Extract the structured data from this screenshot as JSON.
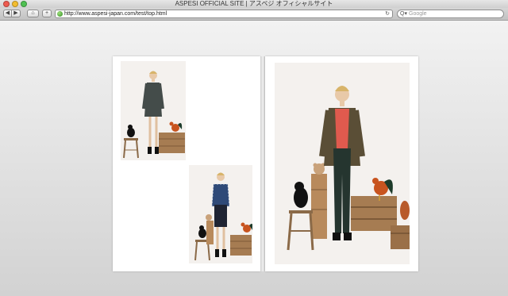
{
  "window": {
    "title": "ASPESI OFFICIAL SITE | アスペジ オフィシャルサイト"
  },
  "toolbar": {
    "back_icon": "◀",
    "forward_icon": "▶",
    "home_icon": "⌂",
    "add_icon": "+",
    "url": "http://www.aspesi-japan.com/test/top.html",
    "reload_icon": "↻",
    "search_icon": "Q▾",
    "search_placeholder": "Google"
  },
  "colors": {
    "close": "#ee5a4f",
    "minimize": "#f2bd2f",
    "maximize": "#4fc152"
  }
}
